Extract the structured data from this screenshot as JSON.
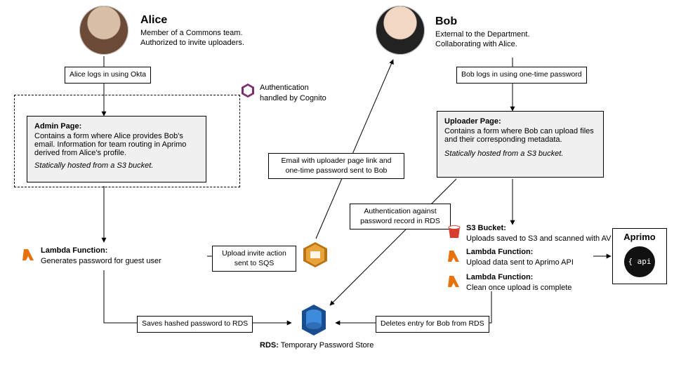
{
  "actors": {
    "alice": {
      "name": "Alice",
      "line1": "Member of a Commons team.",
      "line2": "Authorized to invite uploaders."
    },
    "bob": {
      "name": "Bob",
      "line1": "External to the Department.",
      "line2": "Collaborating with Alice."
    }
  },
  "cognito_label": "Authentication handled by Cognito",
  "admin_page": {
    "title": "Admin Page:",
    "body": "Contains a form where Alice provides Bob's email. Information for team routing in Aprimo derived from Alice's profile.",
    "hosted": "Statically hosted from a S3 bucket."
  },
  "uploader_page": {
    "title": "Uploader Page:",
    "body": "Contains a form where Bob can upload files and their corresponding metadata.",
    "hosted": "Statically hosted from a S3 bucket."
  },
  "lambdas": {
    "guest_pwd": {
      "title": "Lambda Function:",
      "body": "Generates password for guest user"
    },
    "upload_api": {
      "title": "Lambda Function:",
      "body": "Upload data sent to Aprimo API"
    },
    "cleanup": {
      "title": "Lambda Function:",
      "body": "Clean once upload is complete"
    }
  },
  "s3_bucket": {
    "title": "S3 Bucket:",
    "body": "Uploads saved to S3 and scanned with AV"
  },
  "rds": {
    "label": "RDS:",
    "desc": "Temporary Password Store"
  },
  "aprimo": {
    "title": "Aprimo",
    "badge": "{ api }"
  },
  "edges": {
    "alice_login": "Alice logs in using Okta",
    "bob_login": "Bob logs in using one-time password",
    "invite_sqs": "Upload invite action sent to SQS",
    "email_sent": "Email with uploader page link and one-time password sent to Bob",
    "auth_rds": "Authentication against password record in RDS",
    "save_rds": "Saves hashed password to RDS",
    "delete_rds": "Deletes entry for Bob from RDS"
  }
}
